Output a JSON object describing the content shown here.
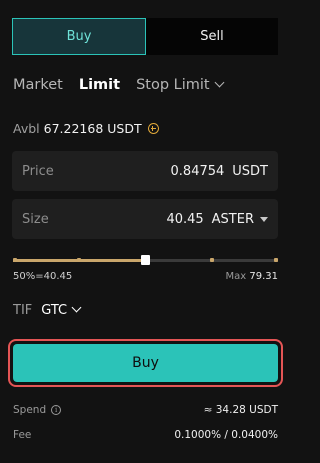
{
  "side_toggle": {
    "buy": "Buy",
    "sell": "Sell"
  },
  "order_types": {
    "market": "Market",
    "limit": "Limit",
    "stop_limit": "Stop Limit"
  },
  "available": {
    "label": "Avbl",
    "value": "67.22168 USDT"
  },
  "price": {
    "label": "Price",
    "value": "0.84754",
    "unit": "USDT"
  },
  "size": {
    "label": "Size",
    "value": "40.45",
    "unit": "ASTER"
  },
  "slider": {
    "left_text": "50%=40.45",
    "max_label": "Max",
    "max_value": "79.31",
    "fraction": 0.5
  },
  "tif": {
    "label": "TIF",
    "value": "GTC"
  },
  "submit": {
    "label": "Buy"
  },
  "spend": {
    "label": "Spend",
    "value": "≈ 34.28 USDT"
  },
  "fee": {
    "label": "Fee",
    "value": "0.1000% / 0.0400%"
  },
  "colors": {
    "accent": "#2bc3b8",
    "highlight_border": "#e45555",
    "slider": "#c9a66b"
  }
}
